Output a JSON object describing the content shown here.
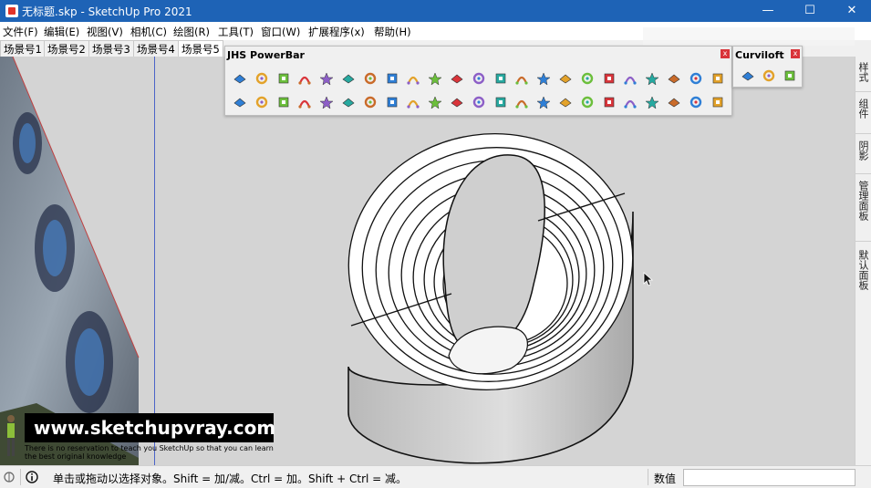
{
  "window": {
    "title": "无标题.skp - SketchUp Pro 2021",
    "controls": {
      "minimize": "—",
      "maximize": "☐",
      "close": "✕"
    }
  },
  "menus": [
    "文件(F)",
    "编辑(E)",
    "视图(V)",
    "相机(C)",
    "绘图(R)",
    "工具(T)",
    "窗口(W)",
    "扩展程序(x)",
    "帮助(H)"
  ],
  "scene_tabs": {
    "items": [
      "场景号1",
      "场景号2",
      "场景号3",
      "场景号4",
      "场景号5"
    ],
    "active_index": 4
  },
  "toolbars": {
    "powerbar": {
      "title": "JHS PowerBar",
      "row1_icons": [
        "push-pull-blue-icon",
        "extrude-blue-icon",
        "face-yellow-icon",
        "face-green-icon",
        "face-red-icon",
        "face-outline-icon",
        "rotate-orange-icon",
        "bend-icon",
        "twist-icon",
        "red-square-icon",
        "rectangle-icon",
        "flag-icon",
        "split-icon",
        "join-icon",
        "arc-icon",
        "dotted-curve-red-icon",
        "dotted-curve-blue-icon",
        "cross-red-icon",
        "cross-green-icon",
        "cross-blue-icon",
        "grid-dots-icon",
        "cone-icon",
        "cone-green-icon"
      ],
      "row2_icons": [
        "warning-triangle-icon",
        "curve-orange-icon",
        "curve-brown-icon",
        "rotate-blue-icon",
        "axes-icon",
        "box-icon",
        "loop-red-icon",
        "explode-green-icon",
        "array-icon",
        "scale-icon",
        "group-icon",
        "diamond-icon",
        "random-icon",
        "section-icon",
        "layers-icon",
        "layers-red-icon",
        "layers-green-icon",
        "tile-orange-icon",
        "tile-orange-icon",
        "tile-orange-icon",
        "delete-x-icon",
        "dotted-arc-icon",
        "grid-square-icon"
      ]
    },
    "curviloft": {
      "title": "Curviloft",
      "icons": [
        "loft-shield-icon",
        "loft-path-icon",
        "loft-skin-icon"
      ]
    },
    "close_glyph": "x"
  },
  "watermark": {
    "url": "www.sketchupvray.com",
    "caption": "There is no reservation to teach you SketchUp so that you can learn the best original knowledge"
  },
  "tray": {
    "tabs": [
      "样式",
      "组件",
      "阴影",
      "管理面板",
      "默认面板"
    ]
  },
  "status": {
    "hint": "单击或拖动以选择对象。Shift = 加/减。Ctrl = 加。Shift + Ctrl = 减。",
    "measurement_label": "数值",
    "measurement_value": ""
  },
  "colors": {
    "titlebar": "#1e63b6",
    "viewport_bg": "#d4d4d4",
    "axis_blue": "#4b63c8"
  }
}
